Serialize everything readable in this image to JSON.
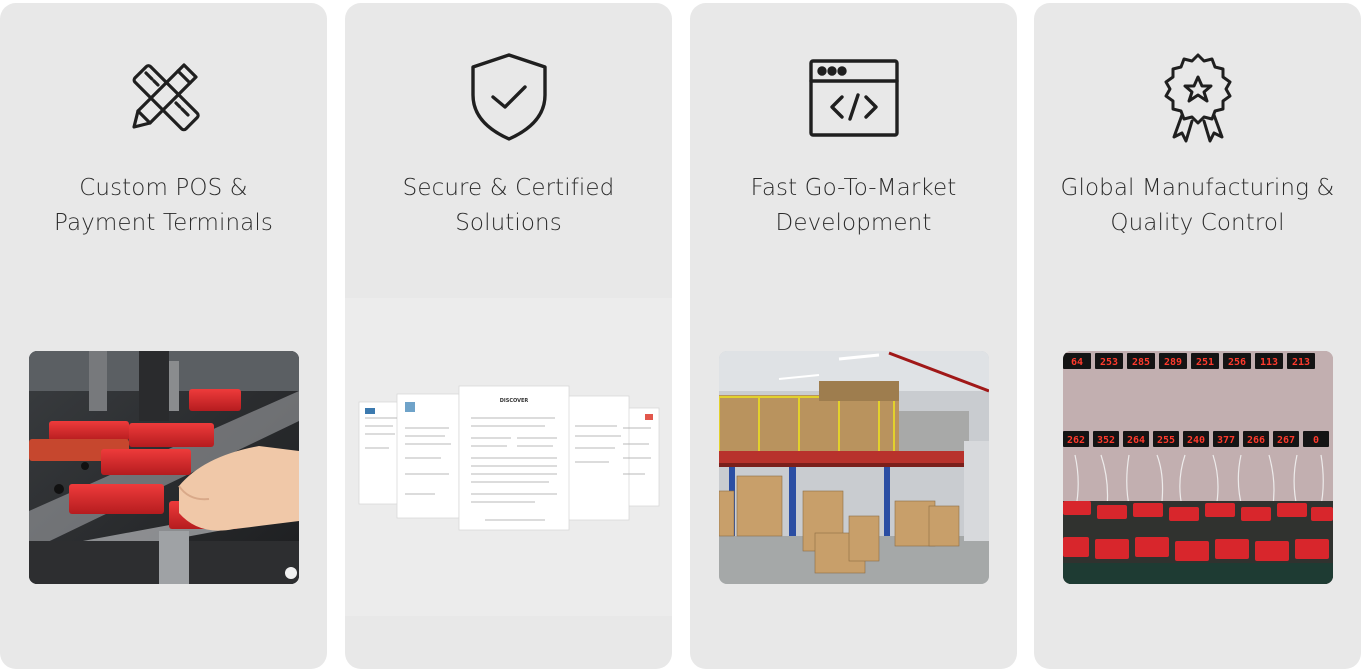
{
  "cards": [
    {
      "icon": "pencil-ruler-icon",
      "title_line1": "Custom POS &",
      "title_line2": "Payment Terminals",
      "image": "pos-assembly-photo"
    },
    {
      "icon": "shield-check-icon",
      "title_line1": "Secure & Certified",
      "title_line2": "Solutions",
      "image": "certification-documents",
      "doc_header": "DISCOVER"
    },
    {
      "icon": "browser-code-icon",
      "title_line1": "Fast Go-To-Market",
      "title_line2": "Development",
      "image": "warehouse-photo"
    },
    {
      "icon": "award-badge-icon",
      "title_line1": "Global Manufacturing &",
      "title_line2": "Quality Control",
      "image": "quality-testing-photo",
      "counter_row1": [
        "64",
        "253",
        "285",
        "289",
        "251",
        "256",
        "113",
        "213"
      ],
      "counter_row2": [
        "262",
        "352",
        "264",
        "255",
        "240",
        "377",
        "266",
        "267",
        "0"
      ]
    }
  ],
  "colors": {
    "card_bg": "#e8e8e8",
    "text": "#2b2b2b",
    "icon_stroke": "#1f1f1f",
    "accent_red": "#d8262c"
  }
}
